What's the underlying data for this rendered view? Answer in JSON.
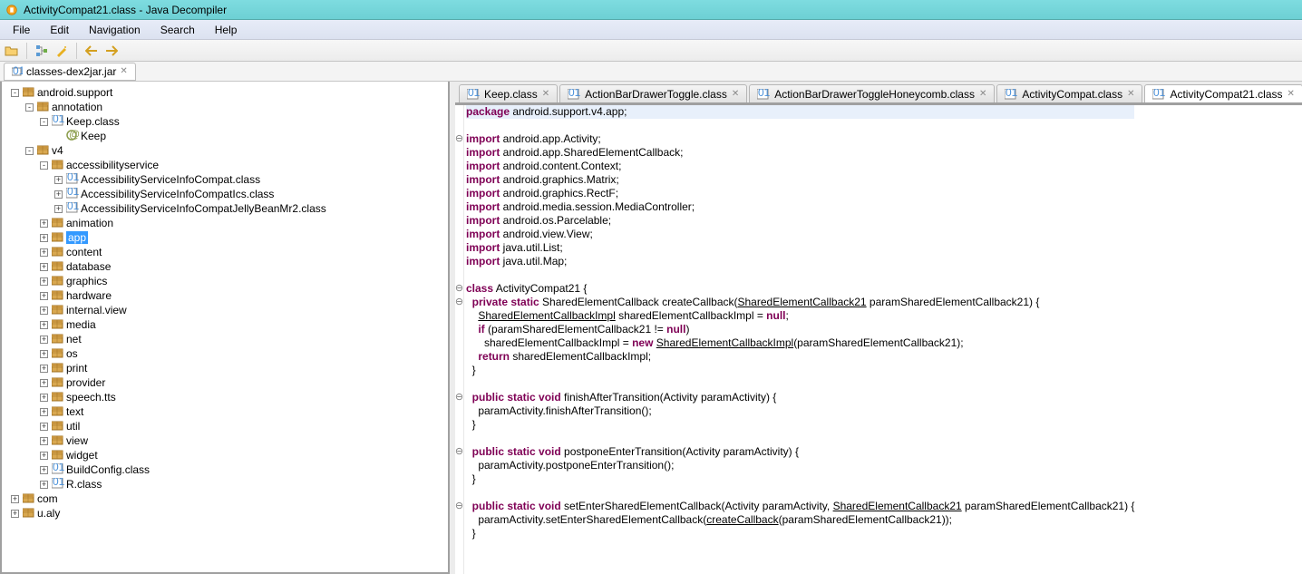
{
  "window": {
    "title": "ActivityCompat21.class - Java Decompiler"
  },
  "menu": [
    "File",
    "Edit",
    "Navigation",
    "Search",
    "Help"
  ],
  "fileTab": {
    "label": "classes-dex2jar.jar"
  },
  "tree": [
    {
      "d": 0,
      "pm": "-",
      "i": "pkg",
      "t": "android.support"
    },
    {
      "d": 1,
      "pm": "-",
      "i": "pkg",
      "t": "annotation"
    },
    {
      "d": 2,
      "pm": "-",
      "i": "cls",
      "t": "Keep.class"
    },
    {
      "d": 3,
      "pm": " ",
      "i": "at",
      "t": "Keep"
    },
    {
      "d": 1,
      "pm": "-",
      "i": "pkg",
      "t": "v4"
    },
    {
      "d": 2,
      "pm": "-",
      "i": "pkg",
      "t": "accessibilityservice"
    },
    {
      "d": 3,
      "pm": "+",
      "i": "cls",
      "t": "AccessibilityServiceInfoCompat.class"
    },
    {
      "d": 3,
      "pm": "+",
      "i": "cls",
      "t": "AccessibilityServiceInfoCompatIcs.class"
    },
    {
      "d": 3,
      "pm": "+",
      "i": "cls",
      "t": "AccessibilityServiceInfoCompatJellyBeanMr2.class"
    },
    {
      "d": 2,
      "pm": "+",
      "i": "pkg",
      "t": "animation"
    },
    {
      "d": 2,
      "pm": "+",
      "i": "pkg",
      "t": "app",
      "sel": true
    },
    {
      "d": 2,
      "pm": "+",
      "i": "pkg",
      "t": "content"
    },
    {
      "d": 2,
      "pm": "+",
      "i": "pkg",
      "t": "database"
    },
    {
      "d": 2,
      "pm": "+",
      "i": "pkg",
      "t": "graphics"
    },
    {
      "d": 2,
      "pm": "+",
      "i": "pkg",
      "t": "hardware"
    },
    {
      "d": 2,
      "pm": "+",
      "i": "pkg",
      "t": "internal.view"
    },
    {
      "d": 2,
      "pm": "+",
      "i": "pkg",
      "t": "media"
    },
    {
      "d": 2,
      "pm": "+",
      "i": "pkg",
      "t": "net"
    },
    {
      "d": 2,
      "pm": "+",
      "i": "pkg",
      "t": "os"
    },
    {
      "d": 2,
      "pm": "+",
      "i": "pkg",
      "t": "print"
    },
    {
      "d": 2,
      "pm": "+",
      "i": "pkg",
      "t": "provider"
    },
    {
      "d": 2,
      "pm": "+",
      "i": "pkg",
      "t": "speech.tts"
    },
    {
      "d": 2,
      "pm": "+",
      "i": "pkg",
      "t": "text"
    },
    {
      "d": 2,
      "pm": "+",
      "i": "pkg",
      "t": "util"
    },
    {
      "d": 2,
      "pm": "+",
      "i": "pkg",
      "t": "view"
    },
    {
      "d": 2,
      "pm": "+",
      "i": "pkg",
      "t": "widget"
    },
    {
      "d": 2,
      "pm": "+",
      "i": "cls",
      "t": "BuildConfig.class"
    },
    {
      "d": 2,
      "pm": "+",
      "i": "cls",
      "t": "R.class"
    },
    {
      "d": 0,
      "pm": "+",
      "i": "pkg",
      "t": "com"
    },
    {
      "d": 0,
      "pm": "+",
      "i": "pkg",
      "t": "u.aly"
    }
  ],
  "editorTabs": [
    {
      "label": "Keep.class",
      "active": false
    },
    {
      "label": "ActionBarDrawerToggle.class",
      "active": false
    },
    {
      "label": "ActionBarDrawerToggleHoneycomb.class",
      "active": false
    },
    {
      "label": "ActivityCompat.class",
      "active": false
    },
    {
      "label": "ActivityCompat21.class",
      "active": true
    }
  ],
  "code": [
    {
      "g": "",
      "hl": true,
      "h": "<span class='kw'>package</span> android.support.v4.app;"
    },
    {
      "g": "",
      "h": ""
    },
    {
      "g": "-",
      "h": "<span class='kw'>import</span> android.app.Activity;"
    },
    {
      "g": "",
      "h": "<span class='kw'>import</span> android.app.SharedElementCallback;"
    },
    {
      "g": "",
      "h": "<span class='kw'>import</span> android.content.Context;"
    },
    {
      "g": "",
      "h": "<span class='kw'>import</span> android.graphics.Matrix;"
    },
    {
      "g": "",
      "h": "<span class='kw'>import</span> android.graphics.RectF;"
    },
    {
      "g": "",
      "h": "<span class='kw'>import</span> android.media.session.MediaController;"
    },
    {
      "g": "",
      "h": "<span class='kw'>import</span> android.os.Parcelable;"
    },
    {
      "g": "",
      "h": "<span class='kw'>import</span> android.view.View;"
    },
    {
      "g": "",
      "h": "<span class='kw'>import</span> java.util.List;"
    },
    {
      "g": "",
      "h": "<span class='kw'>import</span> java.util.Map;"
    },
    {
      "g": "",
      "h": ""
    },
    {
      "g": "-",
      "h": "<span class='kw'>class</span> ActivityCompat21 {"
    },
    {
      "g": "-",
      "h": "  <span class='kw'>private static</span> SharedElementCallback createCallback(<span class='ul'>SharedElementCallback21</span> paramSharedElementCallback21) {"
    },
    {
      "g": "",
      "h": "    <span class='ul'>SharedElementCallbackImpl</span> sharedElementCallbackImpl = <span class='kw'>null</span>;"
    },
    {
      "g": "",
      "h": "    <span class='kw'>if</span> (paramSharedElementCallback21 != <span class='kw'>null</span>)"
    },
    {
      "g": "",
      "h": "      sharedElementCallbackImpl = <span class='kw'>new</span> <span class='ul'>SharedElementCallbackImpl</span>(paramSharedElementCallback21);"
    },
    {
      "g": "",
      "h": "    <span class='kw'>return</span> sharedElementCallbackImpl;"
    },
    {
      "g": "",
      "h": "  }"
    },
    {
      "g": "",
      "h": ""
    },
    {
      "g": "-",
      "h": "  <span class='kw'>public static void</span> finishAfterTransition(Activity paramActivity) {"
    },
    {
      "g": "",
      "h": "    paramActivity.finishAfterTransition();"
    },
    {
      "g": "",
      "h": "  }"
    },
    {
      "g": "",
      "h": ""
    },
    {
      "g": "-",
      "h": "  <span class='kw'>public static void</span> postponeEnterTransition(Activity paramActivity) {"
    },
    {
      "g": "",
      "h": "    paramActivity.postponeEnterTransition();"
    },
    {
      "g": "",
      "h": "  }"
    },
    {
      "g": "",
      "h": ""
    },
    {
      "g": "-",
      "h": "  <span class='kw'>public static void</span> setEnterSharedElementCallback(Activity paramActivity, <span class='ul'>SharedElementCallback21</span> paramSharedElementCallback21) {"
    },
    {
      "g": "",
      "h": "    paramActivity.setEnterSharedElementCallback(<span class='ul'>createCallback</span>(paramSharedElementCallback21));"
    },
    {
      "g": "",
      "h": "  }"
    },
    {
      "g": "",
      "h": ""
    }
  ]
}
